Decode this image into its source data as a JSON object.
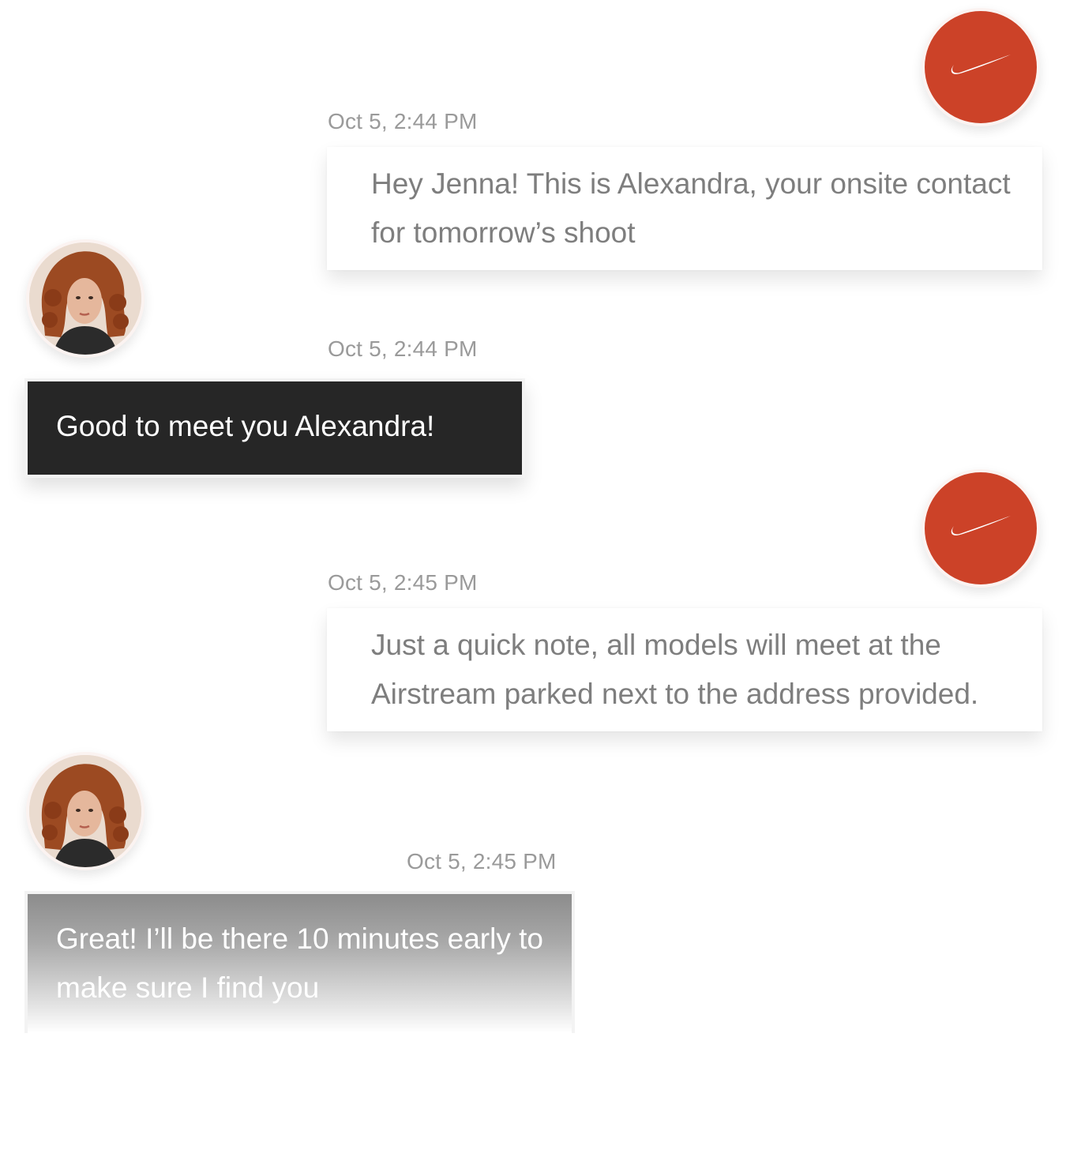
{
  "conversation": {
    "messages": [
      {
        "sender_logo": "nike-swoosh-icon",
        "timestamp": "Oct 5, 2:44 PM",
        "text": "Hey Jenna! This is Alexandra, your onsite contact for tomorrow’s shoot"
      },
      {
        "sender_avatar": "model-portrait",
        "timestamp": "Oct 5, 2:44 PM",
        "text": "Good to meet you Alexandra!"
      },
      {
        "sender_logo": "nike-swoosh-icon",
        "timestamp": "Oct 5, 2:45 PM",
        "text": "Just a quick note, all models will meet at the Airstream parked next to the address provided."
      },
      {
        "sender_avatar": "model-portrait",
        "timestamp": "Oct 5, 2:45 PM",
        "text": "Great! I’ll be there 10 minutes early to make sure I find you"
      }
    ]
  },
  "colors": {
    "brand_red": "#cc4228",
    "dark_bubble": "#262626",
    "timestamp_gray": "#9a9a9a"
  }
}
